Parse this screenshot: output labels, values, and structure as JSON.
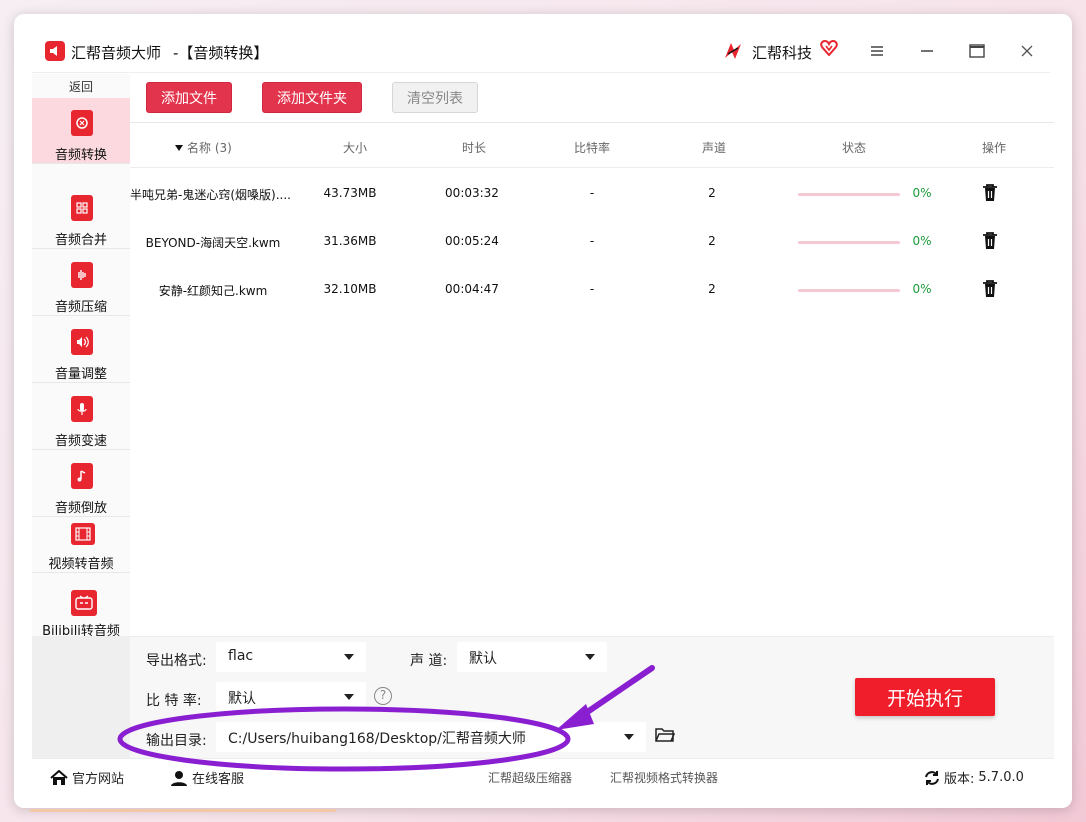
{
  "window": {
    "app_title": "汇帮音频大师",
    "section_title": "-【音频转换】",
    "brand_name": "汇帮科技"
  },
  "sidebar": {
    "back_label": "返回",
    "items": [
      {
        "label": "音频转换",
        "icon": "audio-convert-icon",
        "active": true
      },
      {
        "label": "音频合并",
        "icon": "audio-merge-icon"
      },
      {
        "label": "音频压缩",
        "icon": "audio-compress-icon"
      },
      {
        "label": "音量调整",
        "icon": "volume-icon"
      },
      {
        "label": "音频变速",
        "icon": "microphone-icon"
      },
      {
        "label": "音频倒放",
        "icon": "music-note-icon"
      },
      {
        "label": "视频转音频",
        "icon": "film-icon"
      },
      {
        "label": "Bilibili转音频",
        "icon": "tv-icon"
      }
    ]
  },
  "toolbar": {
    "add_file": "添加文件",
    "add_folder": "添加文件夹",
    "clear_list": "清空列表"
  },
  "table": {
    "columns": [
      "名称 (3)",
      "大小",
      "时长",
      "比特率",
      "声道",
      "状态",
      "操作"
    ],
    "rows": [
      {
        "name": "半吨兄弟-鬼迷心窍(烟嗓版)....",
        "size": "43.73MB",
        "duration": "00:03:32",
        "bitrate": "-",
        "channels": "2",
        "progress": 0,
        "progress_text": "0%"
      },
      {
        "name": "BEYOND-海阔天空.kwm",
        "size": "31.36MB",
        "duration": "00:05:24",
        "bitrate": "-",
        "channels": "2",
        "progress": 0,
        "progress_text": "0%"
      },
      {
        "name": "安静-红颜知己.kwm",
        "size": "32.10MB",
        "duration": "00:04:47",
        "bitrate": "-",
        "channels": "2",
        "progress": 0,
        "progress_text": "0%"
      }
    ]
  },
  "settings": {
    "format_label": "导出格式:",
    "format_value": "flac",
    "channel_label": "声 道:",
    "channel_value": "默认",
    "bitrate_label": "比 特 率:",
    "bitrate_value": "默认",
    "help_glyph": "?",
    "output_label": "输出目录:",
    "output_value": "C:/Users/huibang168/Desktop/汇帮音频大师",
    "start_label": "开始执行"
  },
  "footer": {
    "website": "官方网站",
    "support": "在线客服",
    "link1": "汇帮超级压缩器",
    "link2": "汇帮视频格式转换器",
    "version_label": "版本:",
    "version_value": "5.7.0.0"
  },
  "colors": {
    "accent": "#e2344c",
    "start_button": "#f01e2a",
    "active_nav": "#fbd9de",
    "annotation": "#8a1fd1",
    "progress_track": "#f6c8d4",
    "percent_text": "#1a9a3a"
  }
}
